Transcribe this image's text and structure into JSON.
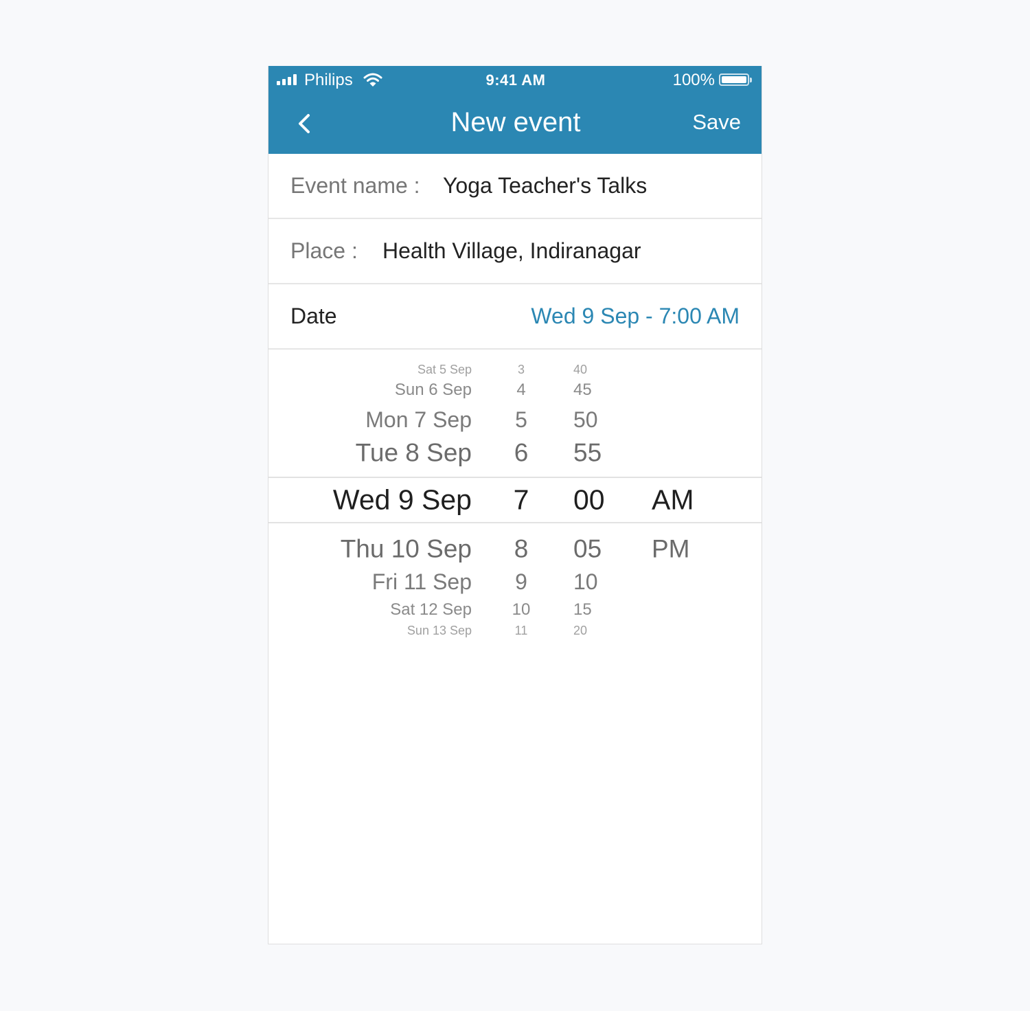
{
  "status_bar": {
    "carrier": "Philips",
    "time": "9:41 AM",
    "battery": "100%"
  },
  "nav": {
    "title": "New event",
    "save_label": "Save"
  },
  "form": {
    "event_name_label": "Event name :",
    "event_name_value": "Yoga Teacher's Talks",
    "place_label": "Place :",
    "place_value": "Health Village, Indiranagar",
    "date_label": "Date",
    "date_value": "Wed 9 Sep - 7:00 AM"
  },
  "picker": {
    "dates": [
      "Sat 5 Sep",
      "Sun 6 Sep",
      "Mon 7 Sep",
      "Tue 8 Sep",
      "Wed 9 Sep",
      "Thu 10 Sep",
      "Fri 11 Sep",
      "Sat 12 Sep",
      "Sun 13 Sep"
    ],
    "hours": [
      "3",
      "4",
      "5",
      "6",
      "7",
      "8",
      "9",
      "10",
      "11"
    ],
    "minutes": [
      "40",
      "45",
      "50",
      "55",
      "00",
      "05",
      "10",
      "15",
      "20"
    ],
    "ampm": [
      "AM",
      "PM"
    ],
    "selected_index": 4
  },
  "colors": {
    "header": "#2b87b3",
    "accent": "#2b87b3"
  }
}
